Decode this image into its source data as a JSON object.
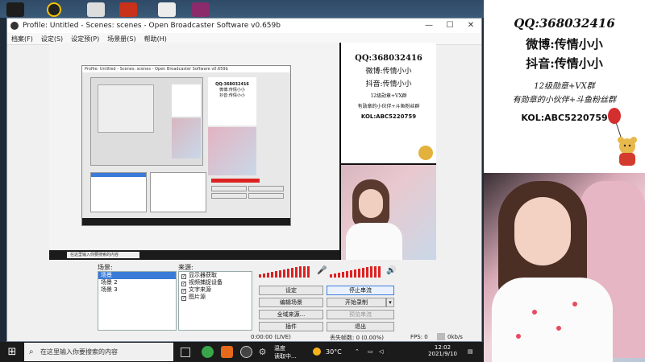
{
  "desktop": {
    "icons": [
      "app-shortcut-icon",
      "app-shortcut-icon",
      "game-shortcut-icon",
      "file-icon",
      "archive-icon"
    ]
  },
  "obs": {
    "title": "Profile: Untitled - Scenes: scenes - Open Broadcaster Software v0.659b",
    "menu": [
      "档案(F)",
      "设定(S)",
      "设定预(P)",
      "场景册(S)",
      "帮助(H)"
    ],
    "scenes_label": "场景:",
    "scenes": [
      "场景",
      "场景 2",
      "场景 3"
    ],
    "sources_label": "来源:",
    "sources": [
      "显示器获取",
      "视频捕捉设备",
      "文字来源",
      "图片源"
    ],
    "buttons": {
      "settings": "设定",
      "stop_stream": "停止串流",
      "edit_scene": "编辑场景",
      "start_record": "开始录制",
      "fullscreen": "全域来源...",
      "preview": "预览串流",
      "plugins": "插件",
      "exit": "退出"
    },
    "status": {
      "time": "0:00:00 (LIVE)",
      "dropped": "丢失帧数: 0 (0.00%)",
      "fps": "FPS: 0",
      "bitrate": "0kb/s"
    }
  },
  "overlay": {
    "qq": "QQ:368032416",
    "weibo": "微博:传情小小",
    "douyin": "抖音:传情小小",
    "line4": "12级勋章+VX群",
    "line5": "有勋章的小伙伴+斗鱼粉丝群",
    "kol": "KOL:ABC5220759"
  },
  "preview_overlay": {
    "qq": "QQ:368032416",
    "weibo": "微博:传情小小",
    "douyin": "抖音:传情小小",
    "line4": "12级勋章+VX群",
    "line5": "有勋章的小伙伴+斗鱼粉丝群",
    "kol": "KOL:ABC5220759"
  },
  "taskbar": {
    "search_placeholder": "在这里输入你要搜索的内容",
    "weather_top": "温度",
    "weather_bottom": "读取中...",
    "temperature": "30°C",
    "time": "12:02",
    "date": "2021/9/10"
  },
  "colors": {
    "meter_red": "#d22222",
    "selection_blue": "#3b7bd8",
    "taskbar": "#1b1b1b"
  }
}
